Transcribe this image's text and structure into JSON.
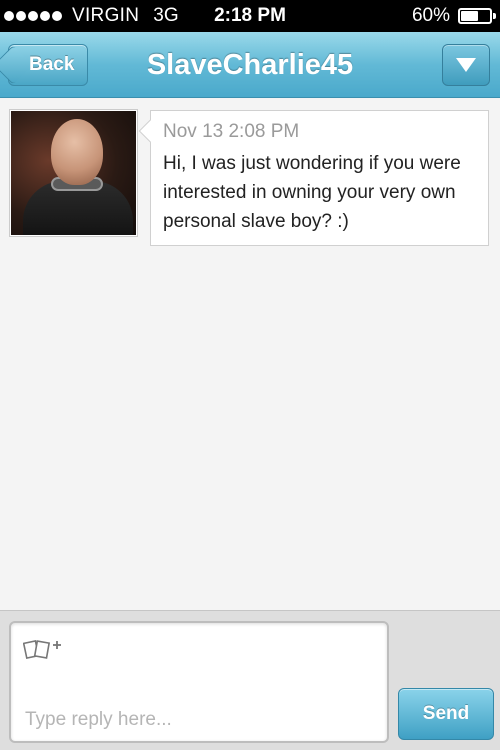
{
  "status_bar": {
    "carrier": "VIRGIN",
    "network": "3G",
    "time": "2:18 PM",
    "battery_percent": "60%",
    "battery_level": 0.6,
    "signal_bars": 5
  },
  "nav": {
    "back_label": "Back",
    "title": "SlaveCharlie45",
    "menu_icon": "chevron-down-icon"
  },
  "messages": [
    {
      "timestamp": "Nov 13 2:08 PM",
      "text": "Hi, I was just wondering if you were interested in owning your very own personal slave boy? :)"
    }
  ],
  "compose": {
    "placeholder": "Type reply here...",
    "value": "",
    "send_label": "Send",
    "photo_icon": "add-photo-icon"
  },
  "colors": {
    "accent": "#4aa9cb",
    "nav_light": "#9ad9ea"
  }
}
